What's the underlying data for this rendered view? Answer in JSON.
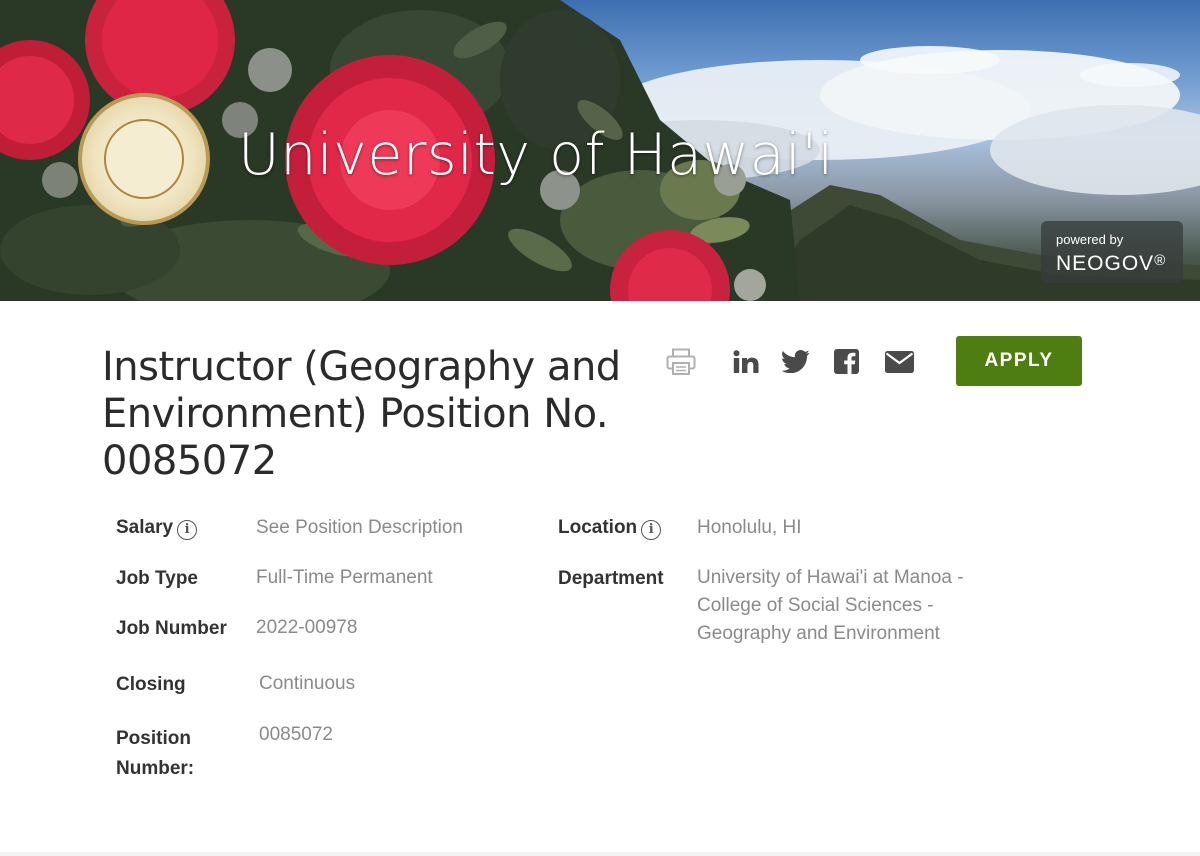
{
  "hero": {
    "title": "University of Hawai'i",
    "powered_by": "powered by",
    "brand": "NEOGOV",
    "brand_mark": "®"
  },
  "job": {
    "title": "Instructor (Geography and Environment) Position No. 0085072",
    "apply_label": "APPLY"
  },
  "share_icons": [
    "print-icon",
    "linkedin-icon",
    "twitter-icon",
    "facebook-icon",
    "email-icon"
  ],
  "details": {
    "salary_label": "Salary",
    "salary_value": "See Position Description",
    "job_type_label": "Job Type",
    "job_type_value": "Full-Time Permanent",
    "job_number_label": "Job Number",
    "job_number_value": "2022-00978",
    "closing_label": "Closing",
    "closing_value": "Continuous",
    "position_number_label_1": "Position",
    "position_number_label_2": "Number:",
    "position_number_value": "0085072",
    "location_label": "Location",
    "location_value": "Honolulu, HI",
    "department_label": "Department",
    "department_line_1": "University of Hawai'i at Manoa -",
    "department_line_2": "College of Social Sciences -",
    "department_line_3": "Geography and Environment"
  },
  "info_glyph": "i",
  "colors": {
    "apply": "#4e7d12",
    "flower": "#e02646",
    "label": "#333333",
    "value": "#8a8a8a"
  }
}
